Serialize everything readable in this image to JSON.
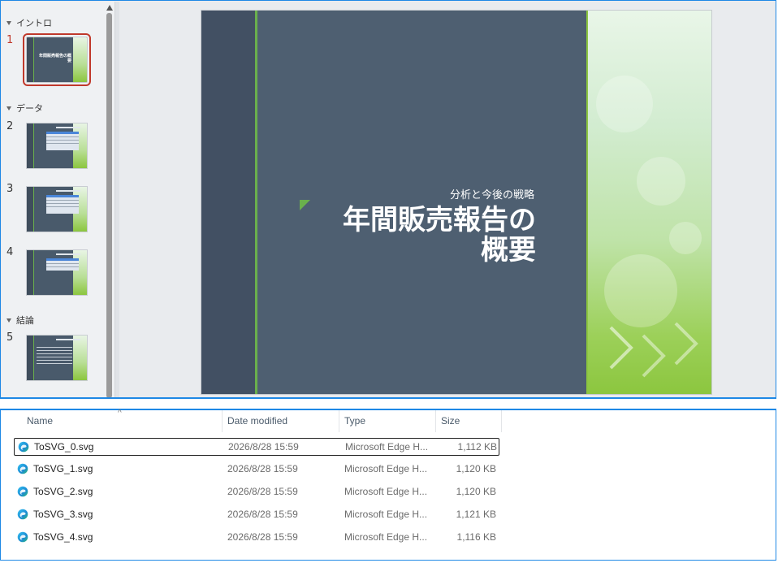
{
  "thumbnails": {
    "sections": [
      {
        "label": "イントロ"
      },
      {
        "label": "データ"
      },
      {
        "label": "結論"
      }
    ],
    "slide_numbers": [
      "1",
      "2",
      "3",
      "4",
      "5"
    ],
    "slide1_title": "年間販売報告の概要"
  },
  "slide": {
    "subtitle": "分析と今後の戦略",
    "title_line1": "年間販売報告の",
    "title_line2": "概要"
  },
  "explorer": {
    "columns": {
      "name": "Name",
      "date": "Date modified",
      "type": "Type",
      "size": "Size"
    },
    "files": [
      {
        "name": "ToSVG_0.svg",
        "date": "2026/8/28 15:59",
        "type": "Microsoft Edge H...",
        "size": "1,112 KB"
      },
      {
        "name": "ToSVG_1.svg",
        "date": "2026/8/28 15:59",
        "type": "Microsoft Edge H...",
        "size": "1,120 KB"
      },
      {
        "name": "ToSVG_2.svg",
        "date": "2026/8/28 15:59",
        "type": "Microsoft Edge H...",
        "size": "1,120 KB"
      },
      {
        "name": "ToSVG_3.svg",
        "date": "2026/8/28 15:59",
        "type": "Microsoft Edge H...",
        "size": "1,121 KB"
      },
      {
        "name": "ToSVG_4.svg",
        "date": "2026/8/28 15:59",
        "type": "Microsoft Edge H...",
        "size": "1,116 KB"
      }
    ]
  },
  "colors": {
    "accent_blue": "#1e88e5",
    "selection_red": "#c0392b",
    "slide_green": "#6ab04c"
  },
  "icons": {
    "file_icon": "edge-icon"
  }
}
